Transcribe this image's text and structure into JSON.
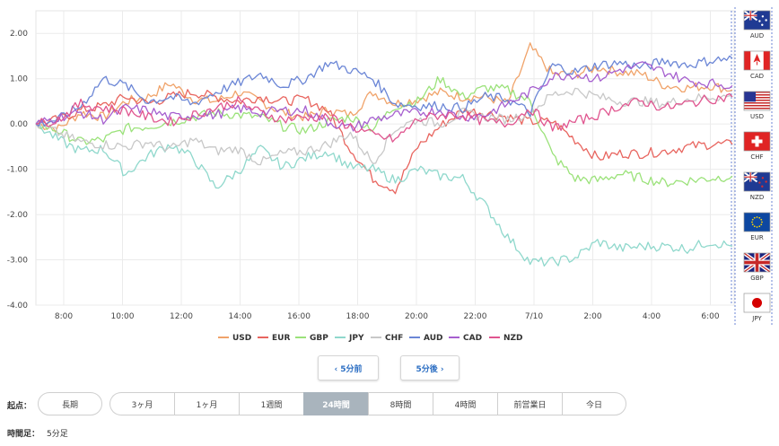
{
  "chart_data": {
    "type": "line",
    "ylim": [
      -4.0,
      2.5
    ],
    "y_ticks": [
      "2.00",
      "1.00",
      "0.00",
      "-1.00",
      "-2.00",
      "-3.00",
      "-4.00"
    ],
    "x_ticks": [
      "8:00",
      "10:00",
      "12:00",
      "14:00",
      "16:00",
      "18:00",
      "20:00",
      "22:00",
      "7/10",
      "2:00",
      "4:00",
      "6:00"
    ],
    "grid": true,
    "legend_position": "bottom",
    "series": [
      {
        "name": "USD",
        "color": "#f0a36a",
        "values": [
          0.0,
          -0.1,
          0.25,
          0.15,
          0.5,
          0.6,
          0.9,
          0.55,
          0.5,
          0.7,
          0.5,
          0.25,
          0.15,
          0.3,
          0.2,
          0.7,
          0.45,
          0.55,
          0.7,
          0.6,
          0.6,
          0.45,
          1.7,
          1.1,
          1.1,
          1.25,
          1.15,
          1.1,
          0.85,
          0.8,
          0.85,
          0.75
        ]
      },
      {
        "name": "EUR",
        "color": "#e8655f",
        "values": [
          0.0,
          0.1,
          0.3,
          0.4,
          0.6,
          0.45,
          0.6,
          0.7,
          0.6,
          0.5,
          0.6,
          0.5,
          0.55,
          0.3,
          -0.55,
          -1.2,
          -1.45,
          -0.5,
          -0.05,
          0.3,
          0.25,
          0.15,
          0.05,
          0.05,
          -0.35,
          -0.75,
          -0.65,
          -0.65,
          -0.6,
          -0.5,
          -0.45,
          -0.45
        ]
      },
      {
        "name": "GBP",
        "color": "#9be27a",
        "values": [
          0.0,
          -0.15,
          -0.4,
          -0.35,
          -0.1,
          -0.05,
          0.05,
          0.15,
          0.25,
          0.2,
          0.15,
          -0.05,
          -0.15,
          0.05,
          0.15,
          -0.1,
          0.4,
          0.5,
          1.0,
          0.6,
          0.8,
          0.75,
          0.5,
          -0.7,
          -1.2,
          -1.25,
          -1.1,
          -1.2,
          -1.3,
          -1.25,
          -1.2,
          -1.15
        ]
      },
      {
        "name": "JPY",
        "color": "#8fd8cc",
        "values": [
          0.0,
          -0.35,
          -0.6,
          -0.55,
          -1.1,
          -0.7,
          -0.45,
          -0.75,
          -1.4,
          -1.05,
          -0.55,
          -0.95,
          -0.75,
          -0.6,
          -0.95,
          -1.0,
          -1.25,
          -1.0,
          -1.15,
          -1.2,
          -1.8,
          -2.5,
          -3.05,
          -3.05,
          -2.95,
          -2.6,
          -2.75,
          -2.7,
          -2.7,
          -2.75,
          -2.6,
          -2.7
        ]
      },
      {
        "name": "CHF",
        "color": "#c8c8c8",
        "values": [
          0.0,
          -0.2,
          -0.4,
          -0.45,
          -0.5,
          -0.4,
          -0.55,
          -0.35,
          -0.6,
          -0.55,
          -0.85,
          -0.65,
          -0.6,
          -0.45,
          -0.2,
          -0.85,
          -0.1,
          0.1,
          0.0,
          0.25,
          0.15,
          0.1,
          0.25,
          0.65,
          0.75,
          0.6,
          0.5,
          0.5,
          0.45,
          0.55,
          0.6,
          0.6
        ]
      },
      {
        "name": "AUD",
        "color": "#6b86d6",
        "values": [
          0.0,
          0.1,
          0.4,
          1.0,
          0.85,
          0.5,
          0.6,
          0.45,
          0.7,
          0.9,
          1.1,
          0.85,
          1.0,
          1.35,
          1.2,
          1.0,
          0.45,
          0.4,
          0.4,
          0.35,
          0.6,
          0.55,
          0.25,
          1.3,
          1.15,
          1.3,
          1.35,
          1.25,
          1.4,
          1.3,
          1.4,
          1.45
        ]
      },
      {
        "name": "CAD",
        "color": "#a65fcf",
        "values": [
          0.0,
          0.15,
          0.25,
          0.1,
          0.35,
          0.3,
          0.15,
          0.2,
          0.2,
          0.35,
          0.25,
          0.3,
          0.3,
          0.05,
          -0.1,
          0.1,
          0.2,
          0.25,
          0.3,
          0.15,
          0.2,
          0.45,
          0.7,
          1.05,
          1.1,
          1.0,
          1.2,
          1.3,
          1.15,
          0.95,
          0.9,
          0.85
        ]
      },
      {
        "name": "NZD",
        "color": "#e0558f",
        "values": [
          0.0,
          0.1,
          0.45,
          0.35,
          0.3,
          0.15,
          0.05,
          0.2,
          0.35,
          0.5,
          0.25,
          0.1,
          0.15,
          0.15,
          -0.05,
          -0.25,
          -0.35,
          0.1,
          0.2,
          0.2,
          0.05,
          0.0,
          0.35,
          -0.1,
          0.05,
          0.2,
          0.4,
          0.5,
          0.35,
          0.45,
          0.55,
          0.6
        ]
      }
    ]
  },
  "flags": [
    {
      "code": "AUD",
      "icon": "australia-flag-icon"
    },
    {
      "code": "CAD",
      "icon": "canada-flag-icon"
    },
    {
      "code": "USD",
      "icon": "usa-flag-icon"
    },
    {
      "code": "CHF",
      "icon": "switzerland-flag-icon"
    },
    {
      "code": "NZD",
      "icon": "new-zealand-flag-icon"
    },
    {
      "code": "EUR",
      "icon": "eu-flag-icon"
    },
    {
      "code": "GBP",
      "icon": "uk-flag-icon"
    },
    {
      "code": "JPY",
      "icon": "japan-flag-icon"
    }
  ],
  "nav": {
    "prev_label": "‹ 5分前",
    "next_label": "5分後 ›"
  },
  "period": {
    "start_label": "起点：",
    "long_label": "長期",
    "options": [
      "3ヶ月",
      "1ヶ月",
      "1週間",
      "24時間",
      "8時間",
      "4時間",
      "前営業日",
      "今日"
    ],
    "active": "24時間"
  },
  "bar": {
    "label": "時間足：",
    "value": "5分足"
  }
}
